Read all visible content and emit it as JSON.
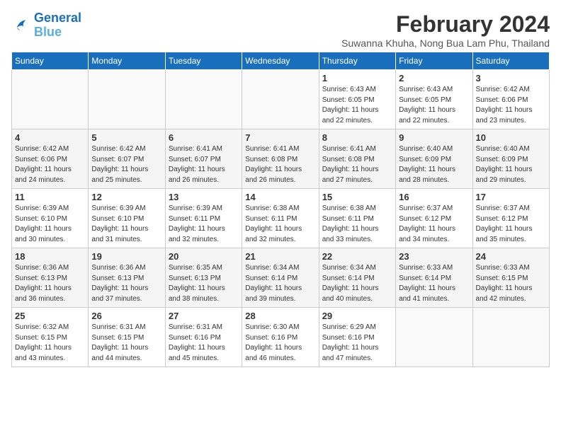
{
  "logo": {
    "line1": "General",
    "line2": "Blue"
  },
  "title": "February 2024",
  "location": "Suwanna Khuha, Nong Bua Lam Phu, Thailand",
  "days_of_week": [
    "Sunday",
    "Monday",
    "Tuesday",
    "Wednesday",
    "Thursday",
    "Friday",
    "Saturday"
  ],
  "weeks": [
    [
      {
        "day": "",
        "info": ""
      },
      {
        "day": "",
        "info": ""
      },
      {
        "day": "",
        "info": ""
      },
      {
        "day": "",
        "info": ""
      },
      {
        "day": "1",
        "info": "Sunrise: 6:43 AM\nSunset: 6:05 PM\nDaylight: 11 hours\nand 22 minutes."
      },
      {
        "day": "2",
        "info": "Sunrise: 6:43 AM\nSunset: 6:05 PM\nDaylight: 11 hours\nand 22 minutes."
      },
      {
        "day": "3",
        "info": "Sunrise: 6:42 AM\nSunset: 6:06 PM\nDaylight: 11 hours\nand 23 minutes."
      }
    ],
    [
      {
        "day": "4",
        "info": "Sunrise: 6:42 AM\nSunset: 6:06 PM\nDaylight: 11 hours\nand 24 minutes."
      },
      {
        "day": "5",
        "info": "Sunrise: 6:42 AM\nSunset: 6:07 PM\nDaylight: 11 hours\nand 25 minutes."
      },
      {
        "day": "6",
        "info": "Sunrise: 6:41 AM\nSunset: 6:07 PM\nDaylight: 11 hours\nand 26 minutes."
      },
      {
        "day": "7",
        "info": "Sunrise: 6:41 AM\nSunset: 6:08 PM\nDaylight: 11 hours\nand 26 minutes."
      },
      {
        "day": "8",
        "info": "Sunrise: 6:41 AM\nSunset: 6:08 PM\nDaylight: 11 hours\nand 27 minutes."
      },
      {
        "day": "9",
        "info": "Sunrise: 6:40 AM\nSunset: 6:09 PM\nDaylight: 11 hours\nand 28 minutes."
      },
      {
        "day": "10",
        "info": "Sunrise: 6:40 AM\nSunset: 6:09 PM\nDaylight: 11 hours\nand 29 minutes."
      }
    ],
    [
      {
        "day": "11",
        "info": "Sunrise: 6:39 AM\nSunset: 6:10 PM\nDaylight: 11 hours\nand 30 minutes."
      },
      {
        "day": "12",
        "info": "Sunrise: 6:39 AM\nSunset: 6:10 PM\nDaylight: 11 hours\nand 31 minutes."
      },
      {
        "day": "13",
        "info": "Sunrise: 6:39 AM\nSunset: 6:11 PM\nDaylight: 11 hours\nand 32 minutes."
      },
      {
        "day": "14",
        "info": "Sunrise: 6:38 AM\nSunset: 6:11 PM\nDaylight: 11 hours\nand 32 minutes."
      },
      {
        "day": "15",
        "info": "Sunrise: 6:38 AM\nSunset: 6:11 PM\nDaylight: 11 hours\nand 33 minutes."
      },
      {
        "day": "16",
        "info": "Sunrise: 6:37 AM\nSunset: 6:12 PM\nDaylight: 11 hours\nand 34 minutes."
      },
      {
        "day": "17",
        "info": "Sunrise: 6:37 AM\nSunset: 6:12 PM\nDaylight: 11 hours\nand 35 minutes."
      }
    ],
    [
      {
        "day": "18",
        "info": "Sunrise: 6:36 AM\nSunset: 6:13 PM\nDaylight: 11 hours\nand 36 minutes."
      },
      {
        "day": "19",
        "info": "Sunrise: 6:36 AM\nSunset: 6:13 PM\nDaylight: 11 hours\nand 37 minutes."
      },
      {
        "day": "20",
        "info": "Sunrise: 6:35 AM\nSunset: 6:13 PM\nDaylight: 11 hours\nand 38 minutes."
      },
      {
        "day": "21",
        "info": "Sunrise: 6:34 AM\nSunset: 6:14 PM\nDaylight: 11 hours\nand 39 minutes."
      },
      {
        "day": "22",
        "info": "Sunrise: 6:34 AM\nSunset: 6:14 PM\nDaylight: 11 hours\nand 40 minutes."
      },
      {
        "day": "23",
        "info": "Sunrise: 6:33 AM\nSunset: 6:14 PM\nDaylight: 11 hours\nand 41 minutes."
      },
      {
        "day": "24",
        "info": "Sunrise: 6:33 AM\nSunset: 6:15 PM\nDaylight: 11 hours\nand 42 minutes."
      }
    ],
    [
      {
        "day": "25",
        "info": "Sunrise: 6:32 AM\nSunset: 6:15 PM\nDaylight: 11 hours\nand 43 minutes."
      },
      {
        "day": "26",
        "info": "Sunrise: 6:31 AM\nSunset: 6:15 PM\nDaylight: 11 hours\nand 44 minutes."
      },
      {
        "day": "27",
        "info": "Sunrise: 6:31 AM\nSunset: 6:16 PM\nDaylight: 11 hours\nand 45 minutes."
      },
      {
        "day": "28",
        "info": "Sunrise: 6:30 AM\nSunset: 6:16 PM\nDaylight: 11 hours\nand 46 minutes."
      },
      {
        "day": "29",
        "info": "Sunrise: 6:29 AM\nSunset: 6:16 PM\nDaylight: 11 hours\nand 47 minutes."
      },
      {
        "day": "",
        "info": ""
      },
      {
        "day": "",
        "info": ""
      }
    ]
  ]
}
